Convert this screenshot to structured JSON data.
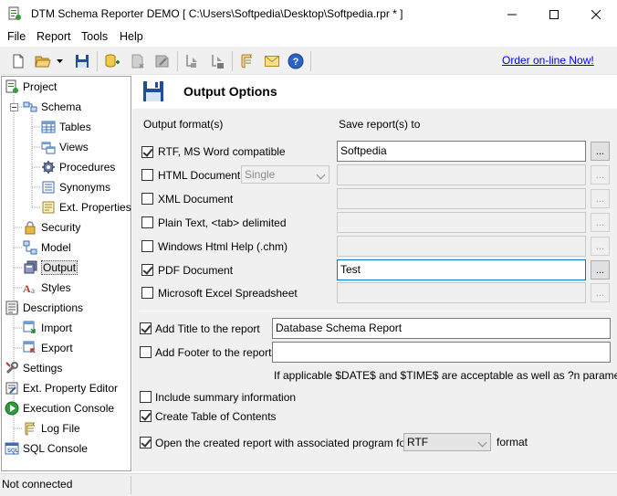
{
  "window": {
    "title": "DTM Schema Reporter DEMO  [ C:\\Users\\Softpedia\\Desktop\\Softpedia.rpr *  ]"
  },
  "menu": [
    "File",
    "Report",
    "Tools",
    "Help"
  ],
  "toolbar": {
    "buttons": [
      "new-icon",
      "open-icon",
      "open-dropdown-icon",
      "save-icon",
      "add-object-icon",
      "delete-object-icon",
      "edit-object-icon",
      "filter-icon",
      "filter-add-icon",
      "script-icon",
      "mail-icon",
      "help-icon"
    ],
    "order_link": "Order on-line Now!"
  },
  "tree": {
    "items": [
      {
        "label": "Project",
        "icon": "project-icon"
      },
      {
        "label": "Schema",
        "icon": "schema-icon"
      },
      {
        "label": "Tables",
        "icon": "tables-icon"
      },
      {
        "label": "Views",
        "icon": "views-icon"
      },
      {
        "label": "Procedures",
        "icon": "procedures-icon"
      },
      {
        "label": "Synonyms",
        "icon": "synonyms-icon"
      },
      {
        "label": "Ext. Properties",
        "icon": "ext-properties-icon"
      },
      {
        "label": "Security",
        "icon": "security-icon"
      },
      {
        "label": "Model",
        "icon": "model-icon"
      },
      {
        "label": "Output",
        "icon": "output-icon"
      },
      {
        "label": "Styles",
        "icon": "styles-icon"
      },
      {
        "label": "Descriptions",
        "icon": "descriptions-icon"
      },
      {
        "label": "Import",
        "icon": "import-icon"
      },
      {
        "label": "Export",
        "icon": "export-icon"
      },
      {
        "label": "Settings",
        "icon": "settings-icon"
      },
      {
        "label": "Ext. Property Editor",
        "icon": "property-editor-icon"
      },
      {
        "label": "Execution Console",
        "icon": "execution-console-icon"
      },
      {
        "label": "Log File",
        "icon": "log-file-icon"
      },
      {
        "label": "SQL Console",
        "icon": "sql-console-icon"
      }
    ]
  },
  "panel": {
    "title": "Output Options",
    "col_format": "Output format(s)",
    "col_save": "Save report(s) to",
    "formats": [
      {
        "label": "RTF, MS Word compatible",
        "checked": true,
        "path": "Softpedia"
      },
      {
        "label": "HTML Document",
        "checked": false,
        "path": "",
        "option": "Single"
      },
      {
        "label": "XML Document",
        "checked": false,
        "path": ""
      },
      {
        "label": "Plain Text, <tab> delimited",
        "checked": false,
        "path": ""
      },
      {
        "label": "Windows Html Help (.chm)",
        "checked": false,
        "path": ""
      },
      {
        "label": "PDF Document",
        "checked": true,
        "path": "Test"
      },
      {
        "label": "Microsoft Excel Spreadsheet",
        "checked": false,
        "path": ""
      }
    ],
    "browse_label": "...",
    "add_title": {
      "label": "Add Title to the report",
      "checked": true,
      "value": "Database Schema Report"
    },
    "add_footer": {
      "label": "Add Footer to the report",
      "checked": false,
      "value": ""
    },
    "note": "If applicable $DATE$ and $TIME$ are acceptable as well as ?n parameters",
    "include_summary": {
      "label": "Include summary information",
      "checked": false
    },
    "create_toc": {
      "label": "Create Table of Contents",
      "checked": true
    },
    "open_report": {
      "label": "Open the created report with associated program for",
      "checked": true,
      "format": "RTF",
      "suffix": "format"
    }
  },
  "status": {
    "text": "Not connected"
  }
}
